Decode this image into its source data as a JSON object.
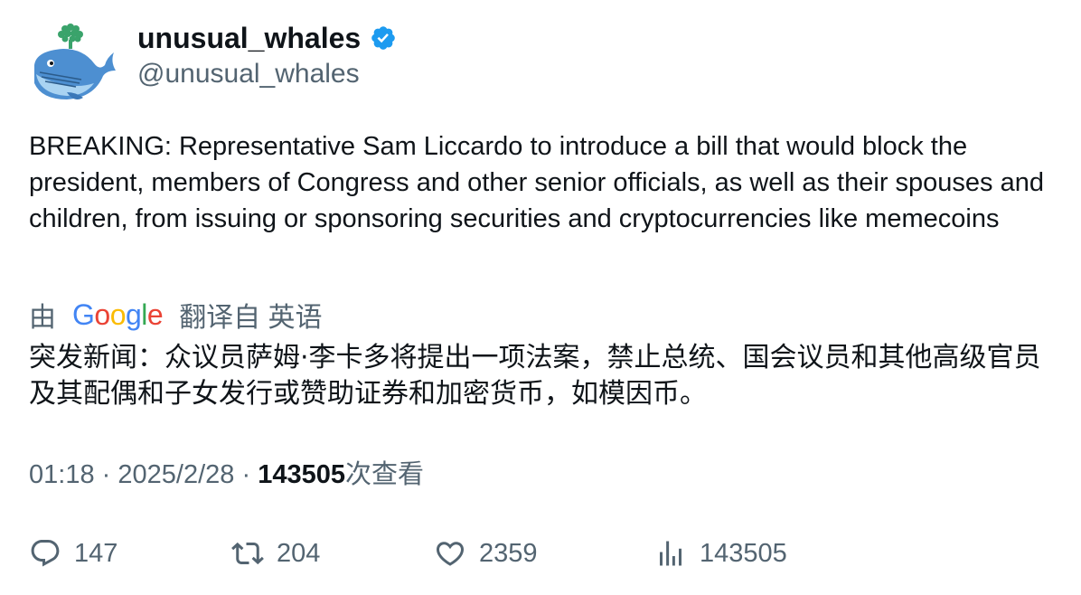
{
  "author": {
    "display_name": "unusual_whales",
    "handle": "@unusual_whales",
    "verified": true,
    "verified_color": "#1d9bf0"
  },
  "tweet": {
    "text": "BREAKING: Representative Sam Liccardo to introduce a bill that would block the president, members of Congress and other senior officials, as well as their spouses and children, from issuing or sponsoring securities and cryptocurrencies like memecoins"
  },
  "translation": {
    "prefix": "由",
    "brand": "Google",
    "suffix": "翻译自 英语",
    "text": "突发新闻：众议员萨姆·李卡多将提出一项法案，禁止总统、国会议员和其他高级官员及其配偶和子女发行或赞助证券和加密货币，如模因币。"
  },
  "meta": {
    "time": "01:18",
    "separator": "·",
    "date": "2025/2/28",
    "views_count": "143505",
    "views_label": "次查看"
  },
  "actions": {
    "replies": "147",
    "retweets": "204",
    "likes": "2359",
    "views": "143505"
  },
  "icons": {
    "reply": "reply-icon",
    "retweet": "retweet-icon",
    "like": "like-icon",
    "views": "views-icon",
    "verified": "verified-badge-icon"
  },
  "colors": {
    "text_primary": "#0f1419",
    "text_secondary": "#536471",
    "google_blue": "#4285f4",
    "google_red": "#ea4335",
    "google_yellow": "#fbbc05",
    "google_green": "#34a853"
  }
}
